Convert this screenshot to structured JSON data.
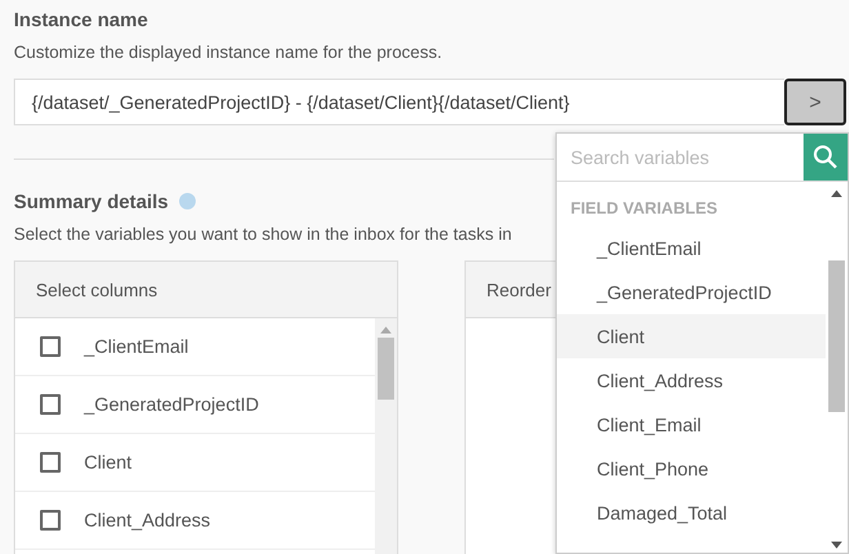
{
  "instance": {
    "title": "Instance name",
    "description": "Customize the displayed instance name for the process.",
    "value": "{/dataset/_GeneratedProjectID} - {/dataset/Client}{/dataset/Client}",
    "button": ">"
  },
  "summary": {
    "title": "Summary details",
    "description": "Select the variables you want to show in the inbox for the tasks in",
    "select_panel": {
      "title": "Select columns",
      "rows": [
        {
          "label": "_ClientEmail",
          "checked": false
        },
        {
          "label": "_GeneratedProjectID",
          "checked": false
        },
        {
          "label": "Client",
          "checked": false
        },
        {
          "label": "Client_Address",
          "checked": false
        }
      ]
    },
    "reorder_panel": {
      "title": "Reorder"
    }
  },
  "dropdown": {
    "placeholder": "Search variables",
    "group": "FIELD VARIABLES",
    "items": [
      {
        "label": "_ClientEmail",
        "selected": false
      },
      {
        "label": "_GeneratedProjectID",
        "selected": false
      },
      {
        "label": "Client",
        "selected": true
      },
      {
        "label": "Client_Address",
        "selected": false
      },
      {
        "label": "Client_Email",
        "selected": false
      },
      {
        "label": "Client_Phone",
        "selected": false
      },
      {
        "label": "Damaged_Total",
        "selected": false
      }
    ]
  }
}
